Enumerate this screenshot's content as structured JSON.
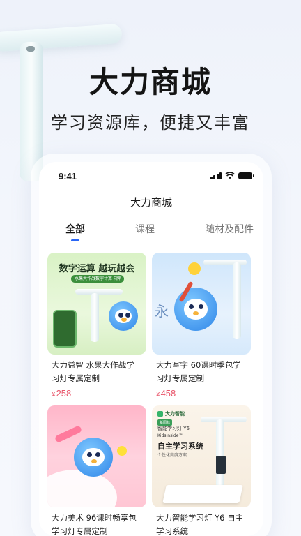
{
  "hero": {
    "title": "大力商城",
    "subtitle": "学习资源库，便捷又丰富"
  },
  "status_bar": {
    "time": "9:41"
  },
  "nav": {
    "title": "大力商城"
  },
  "tabs": [
    {
      "label": "全部",
      "active": true
    },
    {
      "label": "课程",
      "active": false
    },
    {
      "label": "随材及配件",
      "active": false
    }
  ],
  "products": [
    {
      "title": "大力益智 水果大作战学习灯专属定制",
      "price_symbol": "¥",
      "price": "258",
      "image_headline": "数字运算 越玩越会",
      "image_pill": "水果大作战数字计算卡牌"
    },
    {
      "title": "大力写字 60课时季包学习灯专属定制",
      "price_symbol": "¥",
      "price": "458",
      "image_char": "永"
    },
    {
      "title": "大力美术 96课时畅享包 学习灯专属定制",
      "price_symbol": "¥",
      "price": ""
    },
    {
      "title": "大力智能学习灯 Y6 自主学习系统",
      "price_symbol": "¥",
      "price": "",
      "image_brand": "大力智能",
      "image_badge": "新国标",
      "image_line1": "智能学习灯 Y6",
      "image_line2": "KidsInside™",
      "image_line3": "自主学习系统",
      "image_line4": "个性化亮度方案"
    }
  ],
  "colors": {
    "accent": "#2a66f5",
    "price": "#e8556a"
  }
}
